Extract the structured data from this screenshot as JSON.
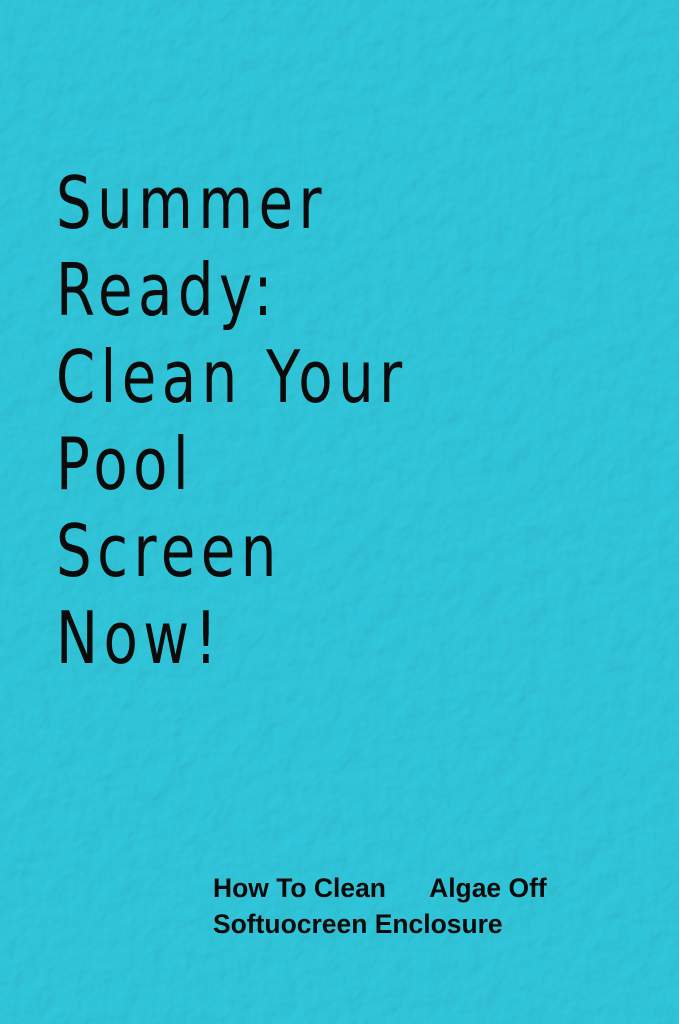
{
  "background": {
    "color": "#3fd6e6",
    "texture": "pebbled-water-texture"
  },
  "headline": {
    "lines": [
      "Summer",
      "Ready:",
      "Clean Your",
      "Pool",
      "Screen",
      "Now!"
    ],
    "color": "#0b0b0b"
  },
  "subtitle": {
    "lines": [
      "How To Clean      Algae Off",
      "Softuocreen Enclosure"
    ],
    "color": "#0b0b0b"
  }
}
